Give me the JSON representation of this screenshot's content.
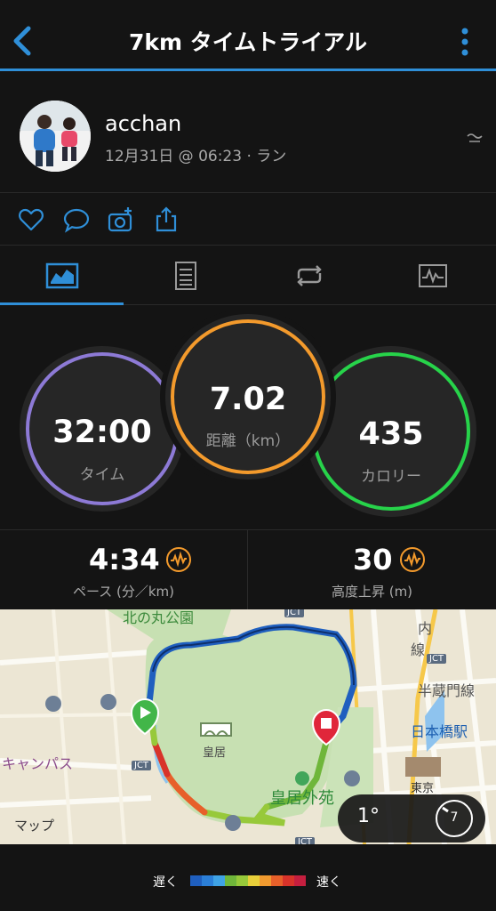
{
  "header": {
    "title": "7km タイムトライアル"
  },
  "profile": {
    "username": "acchan",
    "meta": "12月31日 @ 06:23 · ラン"
  },
  "rings": {
    "time": {
      "value": "32:00",
      "label": "タイム",
      "color": "#8d7ad6"
    },
    "distance": {
      "value": "7.02",
      "label": "距離（km）",
      "color": "#f39a2c"
    },
    "calories": {
      "value": "435",
      "label": "カロリー",
      "color": "#27d34a"
    }
  },
  "stats": {
    "pace": {
      "value": "4:34",
      "label": "ペース (分／km)"
    },
    "elevation": {
      "value": "30",
      "label": "高度上昇 (m)"
    }
  },
  "map": {
    "labels": {
      "park": "北の丸公園",
      "palace": "皇居",
      "outer_garden": "皇居外苑",
      "campus": "キャンパス",
      "hanzomon": "半蔵門線",
      "nihonbashi": "日本橋駅",
      "tokyo": "東京",
      "uchi": "内",
      "sen": "線",
      "jct1": "JCT",
      "jct2": "JCT",
      "jct3": "JCT",
      "jct4": "JCT",
      "maps": "マップ"
    },
    "temperature": "1°",
    "wind": "7"
  },
  "legend": {
    "slow": "遅く",
    "fast": "速く",
    "colors": [
      "#1f5fbf",
      "#2b7fd8",
      "#3fa3e6",
      "#6fb63a",
      "#97c93a",
      "#e8cf3a",
      "#f09a2f",
      "#e7602a",
      "#d8332a",
      "#c51f3f"
    ]
  },
  "colors": {
    "accent": "#2f8fd8",
    "background": "#141414"
  }
}
